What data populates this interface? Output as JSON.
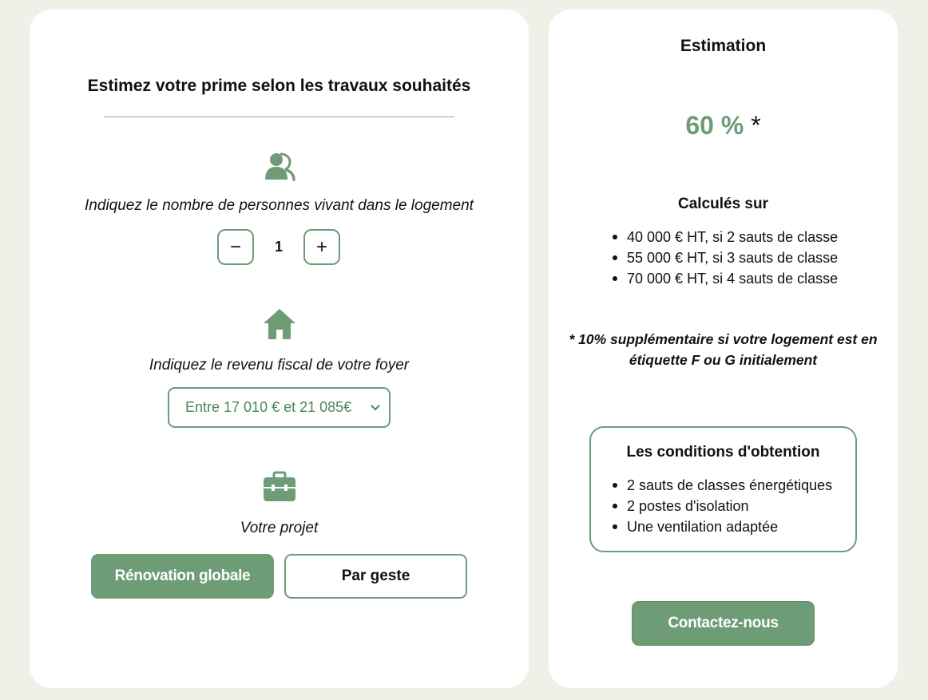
{
  "colors": {
    "accent": "#6e9c76",
    "select_text": "#4c8559",
    "page_background": "#f0f0e8",
    "card_background": "#ffffff"
  },
  "left_panel": {
    "title": "Estimez votre prime selon les travaux souhaités",
    "household": {
      "icon": "users-icon",
      "label": "Indiquez le nombre de personnes vivant dans le logement",
      "minus_label": "−",
      "value": "1",
      "plus_label": "+"
    },
    "income": {
      "icon": "house-icon",
      "label": "Indiquez le revenu fiscal de votre foyer",
      "selected_option": "Entre 17 010 € et 21 085€"
    },
    "project": {
      "icon": "briefcase-icon",
      "label": "Votre projet",
      "option_global": "Rénovation globale",
      "option_geste": "Par geste",
      "selected": "Rénovation globale"
    }
  },
  "right_panel": {
    "title": "Estimation",
    "percent": "60 %",
    "percent_marker": "*",
    "computed_on_title": "Calculés sur",
    "computed_on_items": [
      "40 000 € HT, si 2 sauts de classe",
      "55 000 € HT, si 3 sauts de classe",
      "70 000 € HT, si 4 sauts de classe"
    ],
    "note": "* 10% supplémentaire si votre logement est en étiquette F ou G initialement",
    "conditions": {
      "title": "Les conditions d'obtention",
      "items": [
        "2 sauts de classes énergétiques",
        "2 postes d'isolation",
        "Une ventilation adaptée"
      ]
    },
    "contact_label": "Contactez-nous"
  }
}
